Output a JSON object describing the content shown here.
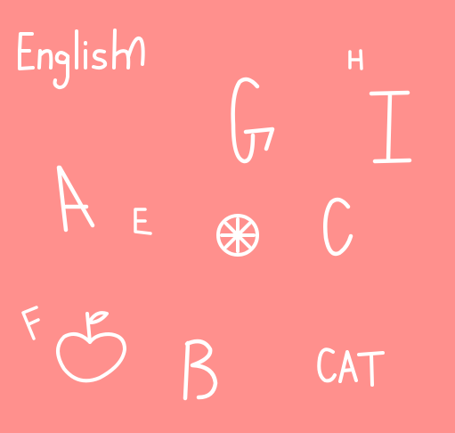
{
  "background_color": "#ff908d",
  "ink_color": "#ffffff",
  "title": "English",
  "letters": {
    "a": "A",
    "b": "B",
    "c": "C",
    "e": "E",
    "f": "F",
    "g": "G",
    "h": "H",
    "i": "I"
  },
  "word": "CAT",
  "drawings": [
    "apple-drawing",
    "orange-slice-drawing"
  ]
}
